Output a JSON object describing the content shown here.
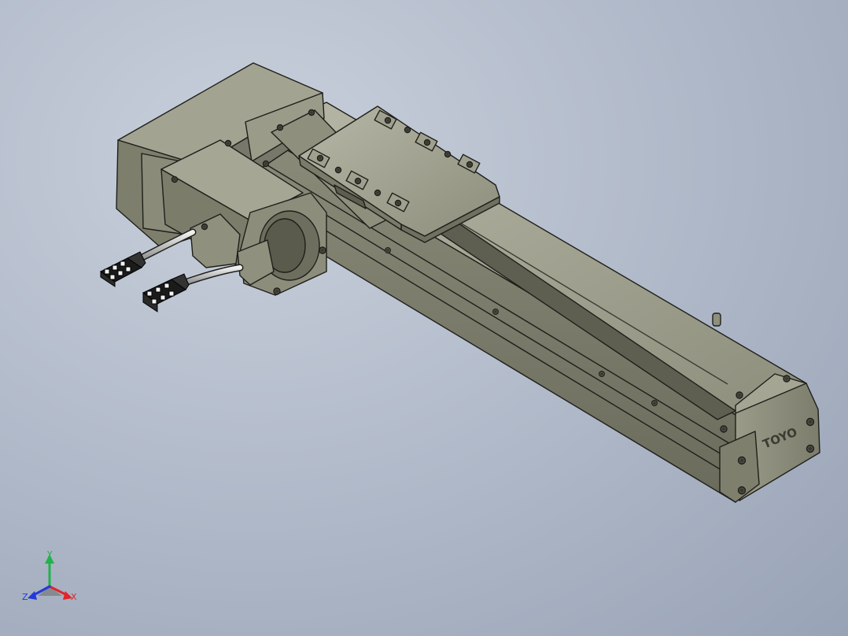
{
  "viewport": {
    "background_top": "#c9d0dc",
    "background_bottom": "#98a3b6",
    "model": {
      "part_color": "#8f907e",
      "part_dark": "#6f705f",
      "part_light": "#b3b4a2",
      "edge_color": "#1e1f1a",
      "cable_color": "#c8c8c8",
      "connector_color": "#1b1b1b",
      "logo_text": "TOYO"
    }
  },
  "triad": {
    "x_label": "X",
    "y_label": "Y",
    "z_label": "Z",
    "x_color": "#e0262b",
    "y_color": "#21b24a",
    "z_color": "#2339d8"
  }
}
